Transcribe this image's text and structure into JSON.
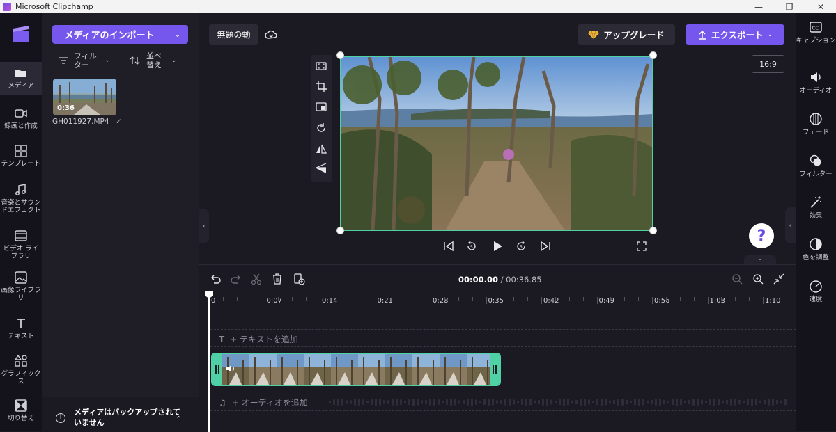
{
  "window": {
    "title": "Microsoft Clipchamp"
  },
  "left_nav": [
    {
      "label": "メディア",
      "icon": "folder-icon",
      "active": true
    },
    {
      "label": "録画と作成",
      "icon": "camera-icon"
    },
    {
      "label": "テンプレート",
      "icon": "template-icon"
    },
    {
      "label": "音楽とサウンドエフェクト",
      "icon": "music-icon"
    },
    {
      "label": "ビデオ ライブラリ",
      "icon": "film-icon"
    },
    {
      "label": "画像ライブラリ",
      "icon": "image-icon"
    },
    {
      "label": "テキスト",
      "icon": "text-icon"
    },
    {
      "label": "グラフィックス",
      "icon": "shapes-icon"
    },
    {
      "label": "切り替え",
      "icon": "transition-icon"
    }
  ],
  "media_panel": {
    "import_label": "メディアのインポート",
    "filter_label": "フィルター",
    "sort_label": "並べ替え",
    "thumb_duration": "0:36",
    "thumb_name": "GH011927.MP4",
    "thumb_check": "✓",
    "backup_text": "メディアはバックアップされていません"
  },
  "header": {
    "project_title": "無題の動",
    "upgrade_label": "アップグレード",
    "export_label": "エクスポート",
    "aspect_ratio": "16:9",
    "help_label": "?"
  },
  "right_nav": [
    {
      "label": "キャプション",
      "icon": "cc-icon"
    },
    {
      "label": "オーディオ",
      "icon": "speaker-icon"
    },
    {
      "label": "フェード",
      "icon": "fade-icon"
    },
    {
      "label": "フィルター",
      "icon": "filter-icon"
    },
    {
      "label": "効果",
      "icon": "wand-icon"
    },
    {
      "label": "色を調整",
      "icon": "contrast-icon"
    },
    {
      "label": "速度",
      "icon": "speedometer-icon"
    }
  ],
  "timeline": {
    "current_time": "00:00.00",
    "total_time": " / 00:36.85",
    "ruler_labels": [
      "0",
      "0:07",
      "0:14",
      "0:21",
      "0:28",
      "0:35",
      "0:42",
      "0:49",
      "0:56",
      "1:03",
      "1:10"
    ],
    "text_track_label": "+ テキストを追加",
    "audio_track_label": "+ オーディオを追加"
  },
  "colors": {
    "accent": "#7657ee",
    "selection": "#4fd1a5",
    "background": "#1b1a23"
  }
}
